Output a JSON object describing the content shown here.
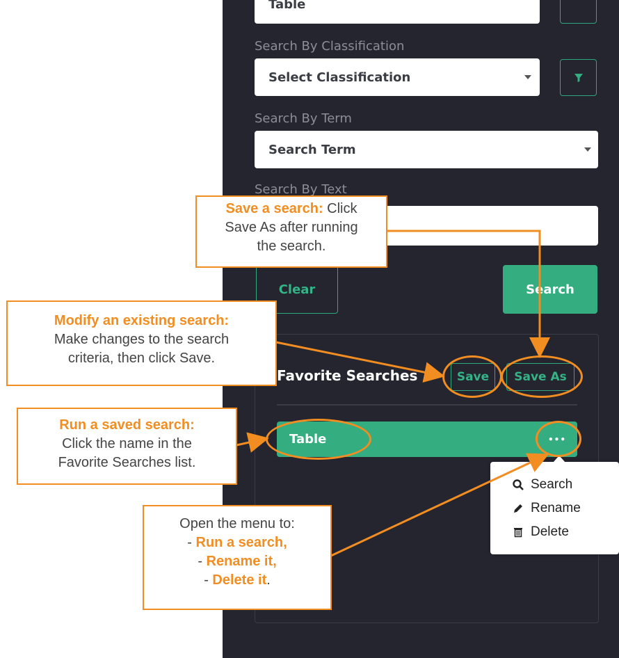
{
  "top_select": {
    "value": "Table"
  },
  "classification": {
    "label": "Search By Classification",
    "placeholder": "Select Classification"
  },
  "term": {
    "label": "Search By Term",
    "placeholder": "Search Term"
  },
  "text": {
    "label": "Search By Text"
  },
  "buttons": {
    "clear": "Clear",
    "search": "Search"
  },
  "favorites": {
    "title": "Favorite Searches",
    "save": "Save",
    "save_as": "Save As",
    "items": [
      {
        "name": "Table",
        "more": "•••"
      }
    ]
  },
  "context_menu": {
    "items": [
      {
        "label": "Search",
        "icon": "search-icon"
      },
      {
        "label": "Rename",
        "icon": "pencil-icon"
      },
      {
        "label": "Delete",
        "icon": "trash-icon"
      }
    ]
  },
  "callouts": {
    "save_search": {
      "bold": "Save a search:",
      "text1": " Click",
      "text2": "Save As after running",
      "text3": "the search."
    },
    "modify": {
      "bold": "Modify an existing search:",
      "text1": "Make changes to the search",
      "text2": "criteria, then click Save."
    },
    "run_saved": {
      "bold": "Run a saved search:",
      "text1": "Click the name in the",
      "text2": "Favorite Searches list."
    },
    "menu": {
      "intro": "Open the menu to:",
      "dash": "- ",
      "run": "Run a search",
      "rename": "Rename it",
      "delete": "Delete it",
      "comma": ",",
      "period": "."
    }
  },
  "colors": {
    "panel": "#24252f",
    "accent": "#34ad81",
    "callout": "#f28d22"
  }
}
